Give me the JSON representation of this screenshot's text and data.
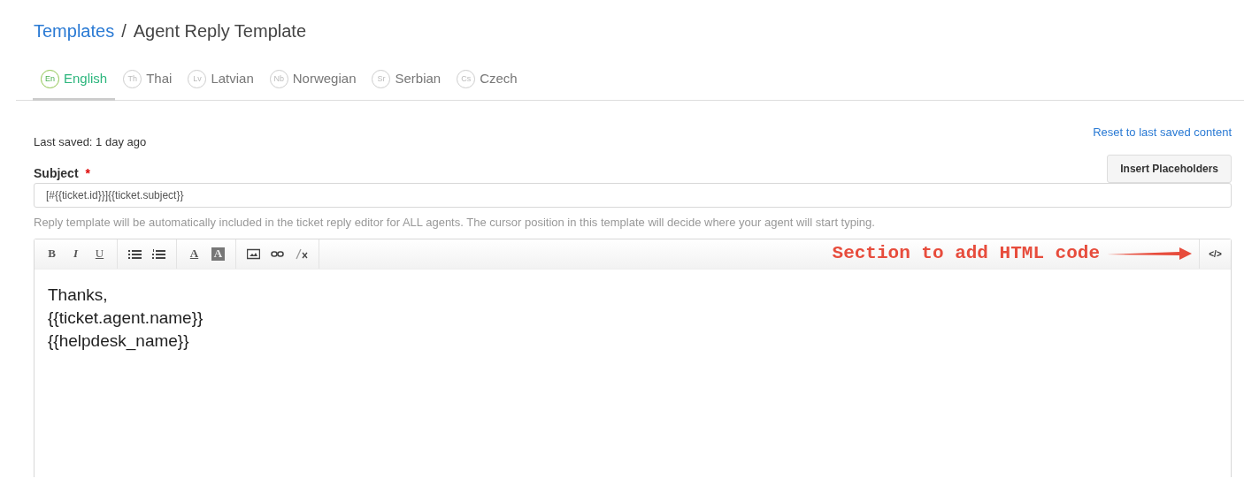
{
  "breadcrumb": [
    {
      "label": "Templates",
      "kind": "link"
    },
    {
      "label": "/",
      "kind": "separator"
    },
    {
      "label": "Agent Reply Template",
      "kind": "current"
    }
  ],
  "tabs": [
    {
      "code": "En",
      "label": "English",
      "selected": true
    },
    {
      "code": "Th",
      "label": "Thai",
      "selected": false
    },
    {
      "code": "Lv",
      "label": "Latvian",
      "selected": false
    },
    {
      "code": "Nb",
      "label": "Norwegian",
      "selected": false
    },
    {
      "code": "Sr",
      "label": "Serbian",
      "selected": false
    },
    {
      "code": "Cs",
      "label": "Czech",
      "selected": false
    }
  ],
  "last_saved": "Last saved: 1 day ago",
  "reset_link": "Reset to last saved content",
  "subject": {
    "label": "Subject",
    "required_mark": "*",
    "value": "[#{{ticket.id}}]{{ticket.subject}}"
  },
  "insert_button": "Insert Placeholders",
  "hint": "Reply template will be automatically included in the ticket reply editor for ALL agents. The cursor position in this template will decide where your agent will start typing.",
  "toolbar": [
    [
      {
        "kind": "bold",
        "label": "B"
      },
      {
        "kind": "italic",
        "label": "I"
      },
      {
        "kind": "underline",
        "label": "U"
      }
    ],
    [
      {
        "kind": "bullet-list"
      },
      {
        "kind": "numbered-list"
      }
    ],
    [
      {
        "kind": "text-color",
        "label": "A"
      },
      {
        "kind": "highlight",
        "label": "A"
      }
    ],
    [
      {
        "kind": "image"
      },
      {
        "kind": "link"
      },
      {
        "kind": "clear-format"
      }
    ]
  ],
  "code_button": "</>",
  "annotation": "Section to add HTML code",
  "editor_lines": [
    "Thanks,",
    "{{ticket.agent.name}}",
    "{{helpdesk_name}}"
  ]
}
